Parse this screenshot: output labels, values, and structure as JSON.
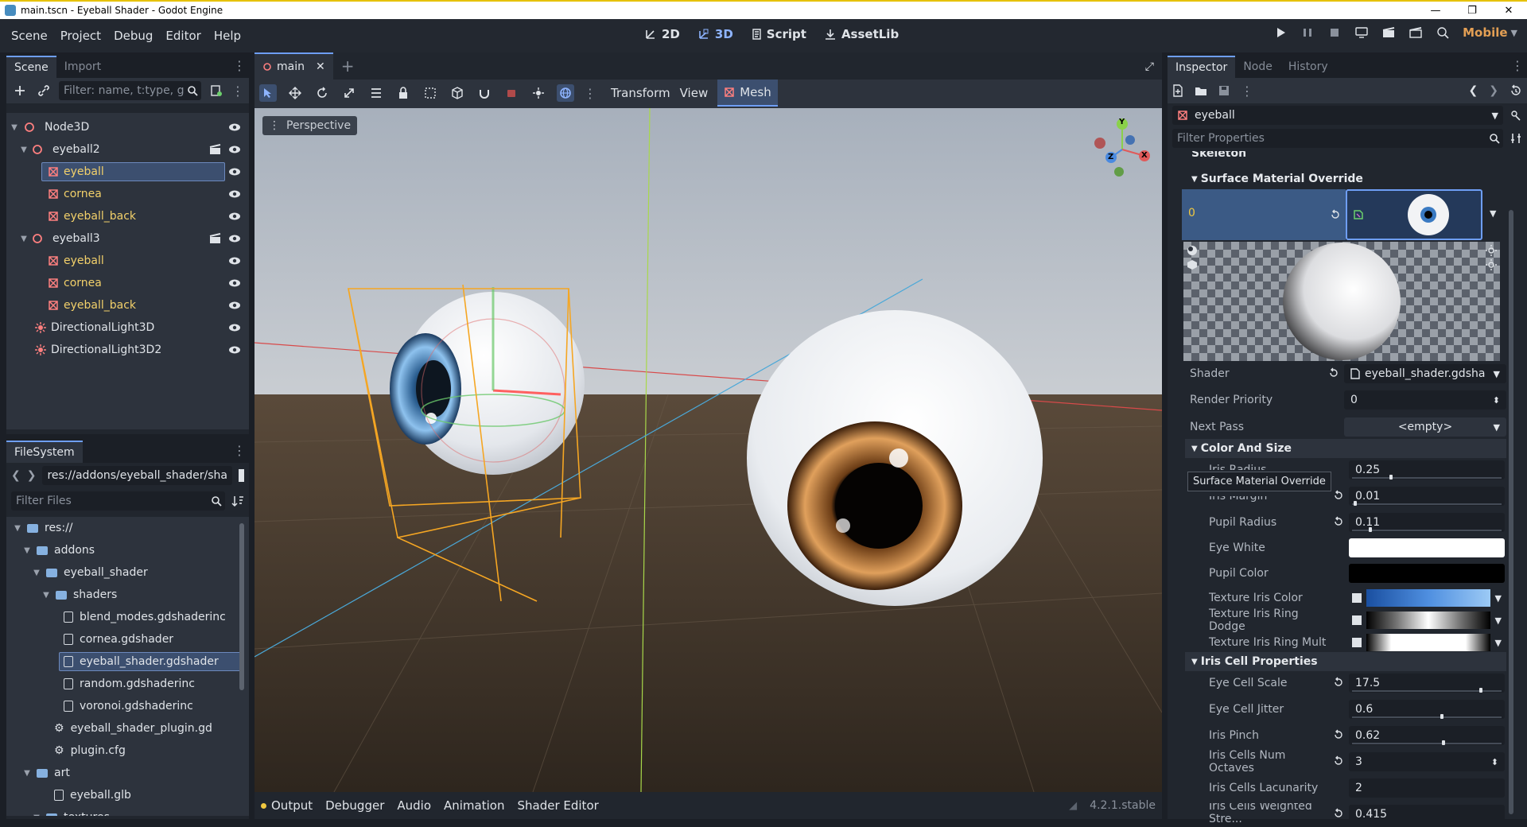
{
  "window": {
    "title": "main.tscn - Eyeball Shader - Godot Engine"
  },
  "menu": [
    "Scene",
    "Project",
    "Debug",
    "Editor",
    "Help"
  ],
  "main_tabs": [
    {
      "label": "2D",
      "icon": "2d-icon"
    },
    {
      "label": "3D",
      "icon": "3d-icon"
    },
    {
      "label": "Script",
      "icon": "script-icon"
    },
    {
      "label": "AssetLib",
      "icon": "assetlib-icon"
    }
  ],
  "renderer": "Mobile",
  "scene_dock": {
    "tabs": [
      "Scene",
      "Import"
    ],
    "filter_placeholder": "Filter: name, t:type, g",
    "nodes": [
      {
        "label": "Node3D",
        "type": "node3d"
      },
      {
        "label": "eyeball2",
        "type": "node3d"
      },
      {
        "label": "eyeball",
        "type": "mesh"
      },
      {
        "label": "cornea",
        "type": "mesh"
      },
      {
        "label": "eyeball_back",
        "type": "mesh"
      },
      {
        "label": "eyeball3",
        "type": "node3d"
      },
      {
        "label": "eyeball",
        "type": "mesh"
      },
      {
        "label": "cornea",
        "type": "mesh"
      },
      {
        "label": "eyeball_back",
        "type": "mesh"
      },
      {
        "label": "DirectionalLight3D",
        "type": "light"
      },
      {
        "label": "DirectionalLight3D2",
        "type": "light"
      }
    ]
  },
  "filesystem_dock": {
    "tab": "FileSystem",
    "path": "res://addons/eyeball_shader/sha",
    "filter_placeholder": "Filter Files",
    "items": [
      {
        "label": "res://",
        "kind": "folder"
      },
      {
        "label": "addons",
        "kind": "folder"
      },
      {
        "label": "eyeball_shader",
        "kind": "folder"
      },
      {
        "label": "shaders",
        "kind": "folder"
      },
      {
        "label": "blend_modes.gdshaderinc",
        "kind": "file"
      },
      {
        "label": "cornea.gdshader",
        "kind": "file"
      },
      {
        "label": "eyeball_shader.gdshader",
        "kind": "file"
      },
      {
        "label": "random.gdshaderinc",
        "kind": "file"
      },
      {
        "label": "voronoi.gdshaderinc",
        "kind": "file"
      },
      {
        "label": "eyeball_shader_plugin.gd",
        "kind": "gear"
      },
      {
        "label": "plugin.cfg",
        "kind": "gear"
      },
      {
        "label": "art",
        "kind": "folder"
      },
      {
        "label": "eyeball.glb",
        "kind": "file"
      },
      {
        "label": "textures",
        "kind": "folder"
      }
    ]
  },
  "editor": {
    "scene_tab": "main",
    "toolbar_menus": [
      "Transform",
      "View"
    ],
    "mesh_menu": "Mesh",
    "perspective": "Perspective",
    "gizmo_axes": {
      "x": "X",
      "y": "Y",
      "z": "Z"
    }
  },
  "bottom_panel": {
    "tabs": [
      "Output",
      "Debugger",
      "Audio",
      "Animation",
      "Shader Editor"
    ],
    "version": "4.2.1.stable"
  },
  "inspector": {
    "tabs": [
      "Inspector",
      "Node",
      "History"
    ],
    "object": "eyeball",
    "filter_placeholder": "Filter Properties",
    "collapsed_section": "Skeleton",
    "surface_section": "Surface Material Override",
    "surface_index": "0",
    "tooltip": "Surface Material Override",
    "shader": {
      "label": "Shader",
      "value": "eyeball_shader.gdsha"
    },
    "render_priority": {
      "label": "Render Priority",
      "value": "0"
    },
    "next_pass": {
      "label": "Next Pass",
      "value": "<empty>"
    },
    "color_size_section": "Color And Size",
    "iris_radius": {
      "label": "Iris Radius",
      "value": "0.25"
    },
    "iris_margin": {
      "label": "Iris Margin",
      "value": "0.01"
    },
    "pupil_radius": {
      "label": "Pupil Radius",
      "value": "0.11"
    },
    "eye_white": {
      "label": "Eye White",
      "color": "#ffffff"
    },
    "pupil_color": {
      "label": "Pupil Color",
      "color": "#000000"
    },
    "texture_iris_color": {
      "label": "Texture Iris Color"
    },
    "texture_iris_ring_dodge": {
      "label": "Texture Iris Ring Dodge"
    },
    "texture_iris_ring_mult": {
      "label": "Texture Iris Ring Mult"
    },
    "iris_cell_section": "Iris Cell Properties",
    "eye_cell_scale": {
      "label": "Eye Cell Scale",
      "value": "17.5"
    },
    "eye_cell_jitter": {
      "label": "Eye Cell Jitter",
      "value": "0.6"
    },
    "iris_pinch": {
      "label": "Iris Pinch",
      "value": "0.62"
    },
    "iris_cells_num_octaves": {
      "label": "Iris Cells Num Octaves",
      "value": "3"
    },
    "iris_cells_lacunarity": {
      "label": "Iris Cells Lacunarity",
      "value": "2"
    },
    "iris_cells_weighted": {
      "label": "Iris Cells Weighted Stre...",
      "value": "0.415"
    }
  },
  "colors": {
    "accent": "#6e9ef5",
    "mesh_node": "#f2d06a",
    "node3d": "#fc7f7f",
    "selection_box": "#f5a623"
  }
}
